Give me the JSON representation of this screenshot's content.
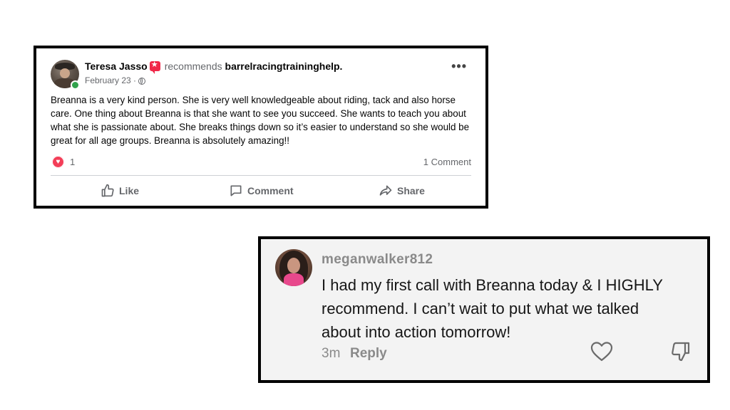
{
  "facebook_post": {
    "author_name": "Teresa Jasso",
    "recommends_text": "recommends",
    "page_name": "barrelracingtraininghelp.",
    "date": "February 23 ·",
    "body": "Breanna is a very kind person. She is very well knowledgeable about riding, tack and also horse care. One thing about Breanna is that she want to see you succeed. She wants to teach you about what she is passionate about. She breaks things down so it’s easier to understand so she would be great for all age groups. Breanna is absolutely amazing!!",
    "reaction_count": "1",
    "comment_count": "1 Comment",
    "actions": {
      "like": "Like",
      "comment": "Comment",
      "share": "Share"
    },
    "colors": {
      "reaction_heart": "#f33e58",
      "recommend_badge": "#f02849",
      "online_dot": "#31a24c"
    },
    "icons": [
      "recommend-icon",
      "globe-icon",
      "more-icon",
      "heart-reaction-icon",
      "like-icon",
      "comment-icon",
      "share-icon"
    ]
  },
  "tiktok_comment": {
    "username": "meganwalker812",
    "text": "I had my first call with Breanna today & I HIGHLY recommend. I can’t wait to put what we talked about into action tomorrow!",
    "time": "3m",
    "reply_label": "Reply",
    "icons": [
      "heart-outline-icon",
      "thumbs-down-icon"
    ]
  }
}
